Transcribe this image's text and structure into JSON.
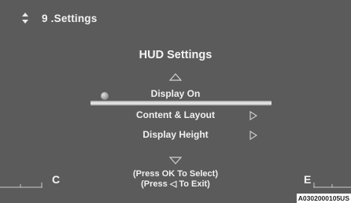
{
  "header": {
    "icon": "up-down-arrows-icon",
    "title": "9 .Settings"
  },
  "menu": {
    "title": "HUD Settings",
    "items": [
      {
        "label": "Display On",
        "selected": true,
        "has_submenu": false
      },
      {
        "label": "Content & Layout",
        "selected": false,
        "has_submenu": true
      },
      {
        "label": "Display Height",
        "selected": false,
        "has_submenu": true
      }
    ],
    "up_icon": "triangle-up-outline-icon",
    "down_icon": "triangle-down-outline-icon"
  },
  "hints": {
    "line1": "(Press OK To Select)",
    "line2": "(Press ◁ To Exit)"
  },
  "gauge": {
    "left_label": "C",
    "right_label": "E"
  },
  "reference_code": "A0302000105US",
  "colors": {
    "screen_bg": "#5b5b5b",
    "text": "#f0f0f0",
    "highlight": "#f2f2f2"
  }
}
